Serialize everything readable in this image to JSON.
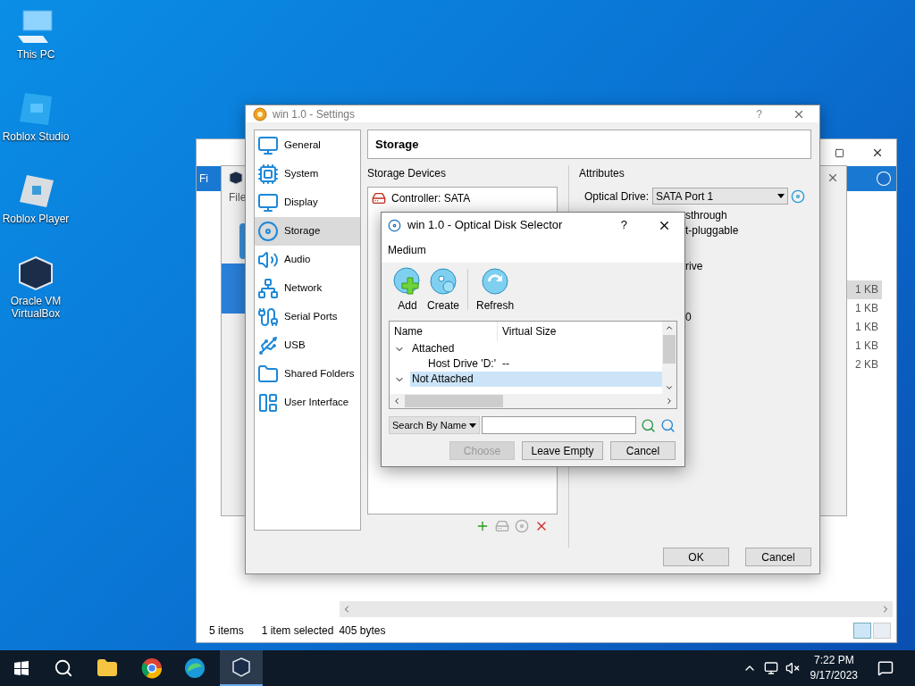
{
  "desktop_icons": [
    {
      "label": "This PC",
      "kind": "pc"
    },
    {
      "label": "Roblox Studio",
      "kind": "studio"
    },
    {
      "label": "Roblox Player",
      "kind": "player"
    },
    {
      "label": "Oracle VM VirtualBox",
      "kind": "vbox"
    }
  ],
  "explorer": {
    "tab_fragment": "Fi",
    "sizes": [
      {
        "text": "1 KB",
        "selected": true
      },
      {
        "text": "1 KB",
        "selected": false
      },
      {
        "text": "1 KB",
        "selected": false
      },
      {
        "text": "1 KB",
        "selected": false
      },
      {
        "text": "2 KB",
        "selected": false
      }
    ],
    "status": [
      "5 items",
      "1 item selected",
      "405 bytes"
    ]
  },
  "manager": {
    "menu_fragment": "File"
  },
  "settings": {
    "title": "win 1.0 - Settings",
    "help": "?",
    "sidebar": [
      {
        "label": "General",
        "kind": "general",
        "selected": false
      },
      {
        "label": "System",
        "kind": "system",
        "selected": false
      },
      {
        "label": "Display",
        "kind": "display",
        "selected": false
      },
      {
        "label": "Storage",
        "kind": "storage",
        "selected": true
      },
      {
        "label": "Audio",
        "kind": "audio",
        "selected": false
      },
      {
        "label": "Network",
        "kind": "network",
        "selected": false
      },
      {
        "label": "Serial Ports",
        "kind": "serial",
        "selected": false
      },
      {
        "label": "USB",
        "kind": "usb",
        "selected": false
      },
      {
        "label": "Shared Folders",
        "kind": "folder",
        "selected": false
      },
      {
        "label": "User Interface",
        "kind": "ui",
        "selected": false
      }
    ],
    "section_title": "Storage",
    "devices_label": "Storage Devices",
    "controller": "Controller: SATA",
    "attributes_label": "Attributes",
    "optical_drive_label": "Optical Drive:",
    "optical_drive_value": "SATA Port 1",
    "fragments": [
      "sthrough",
      "t-pluggable",
      "rive",
      "0"
    ],
    "buttons": [
      "OK",
      "Cancel"
    ]
  },
  "dialog": {
    "title": "win 1.0 - Optical Disk Selector",
    "help": "?",
    "menu": "Medium",
    "tools": [
      {
        "label": "Add",
        "kind": "add"
      },
      {
        "label": "Create",
        "kind": "create"
      },
      {
        "label": "Refresh",
        "kind": "refresh"
      }
    ],
    "columns": [
      "Name",
      "Virtual Size"
    ],
    "tree": [
      {
        "label": "Attached",
        "expanded": true,
        "selected": false,
        "children": [
          {
            "name": "Host Drive 'D:'",
            "size": "--"
          }
        ]
      },
      {
        "label": "Not Attached",
        "expanded": true,
        "selected": true
      }
    ],
    "search_mode": "Search By Name",
    "buttons": [
      {
        "label": "Choose",
        "disabled": true
      },
      {
        "label": "Leave Empty",
        "disabled": false
      },
      {
        "label": "Cancel",
        "disabled": false
      }
    ]
  },
  "taskbar": {
    "time": "7:22 PM",
    "date": "9/17/2023"
  }
}
